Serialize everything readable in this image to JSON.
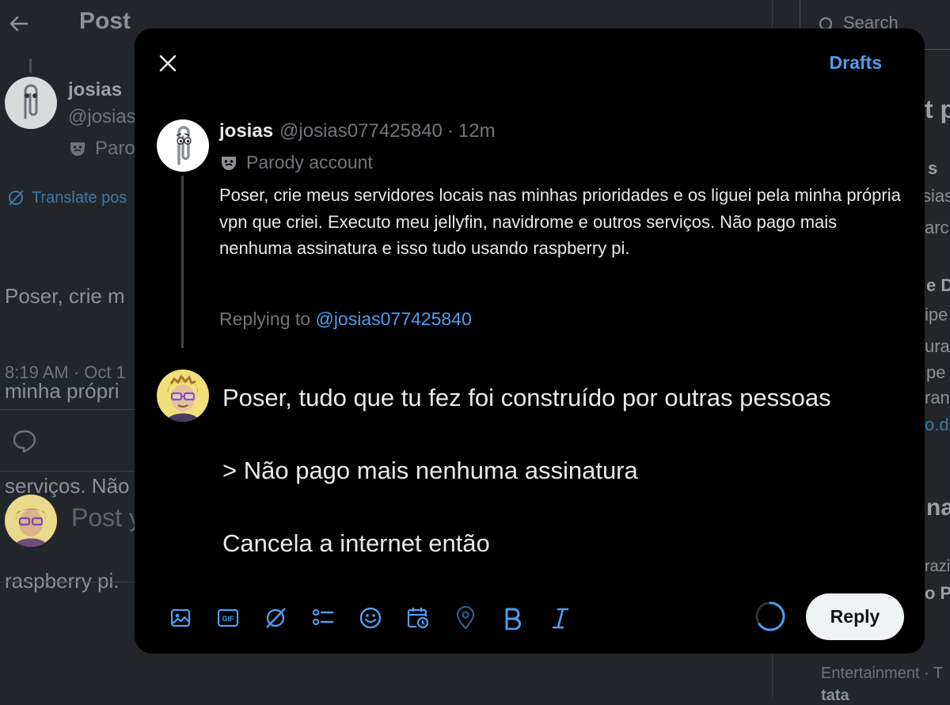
{
  "background": {
    "header": {
      "title": "Post"
    },
    "post": {
      "author_name": "josias",
      "author_handle": "@josias",
      "parody_label": "Parod",
      "translate_label": "Translate pos",
      "text_lines": [
        "Poser, crie m",
        "minha própri",
        "serviços. Não",
        "raspberry pi."
      ],
      "timestamp": "8:19 AM · Oct 1"
    },
    "composer_placeholder": "Post y",
    "sidebar": {
      "search_placeholder": "Search",
      "fragments": [
        "t p",
        "s",
        "sias",
        "arc",
        "e D",
        "ipe",
        "ura",
        "pe",
        "ran",
        "o.d",
        "na",
        "razi",
        "o P"
      ],
      "entertainment_label": "Entertainment · T",
      "entertainment_sub": "tata"
    }
  },
  "modal": {
    "drafts_label": "Drafts",
    "original_post": {
      "name": "josias",
      "handle": "@josias077425840",
      "separator": "·",
      "time": "12m",
      "parody_label": "Parody account",
      "text": "Poser, crie meus servidores locais nas minhas prioridades e os liguei pela minha própria vpn que criei. Executo meu jellyfin, navidrome e outros serviços. Não pago mais nenhuma assinatura e isso tudo usando raspberry pi.",
      "replying_prefix": "Replying to ",
      "replying_handle": "@josias077425840"
    },
    "reply_draft": {
      "line1": "Poser, tudo que tu fez foi construído por outras pessoas",
      "line2": "> Não pago mais nenhuma assinatura",
      "line3": "Cancela a internet então"
    },
    "toolbar_icons": [
      "image-icon",
      "gif-icon",
      "grok-icon",
      "poll-icon",
      "emoji-icon",
      "schedule-icon",
      "location-icon",
      "bold-icon",
      "italic-icon"
    ],
    "character_progress": 0.65,
    "reply_button_label": "Reply",
    "colors": {
      "accent": "#4d9ef0",
      "background": "#000000",
      "reply_button_bg": "#eff3f4"
    }
  }
}
